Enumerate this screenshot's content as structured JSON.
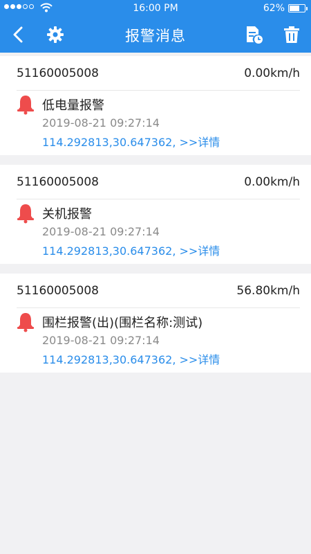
{
  "status_bar": {
    "signal_icon": "signal-dots-icon",
    "wifi_icon": "wifi-icon",
    "time": "16:00 PM",
    "battery_text": "62%",
    "battery_level": 0.62
  },
  "nav": {
    "title": "报警消息",
    "back_icon": "chevron-left-icon",
    "settings_icon": "gear-icon",
    "report_icon": "document-clock-icon",
    "delete_icon": "trash-icon"
  },
  "colors": {
    "header": "#2a8dea",
    "bell": "#ee4c4c",
    "link": "#2a8dea"
  },
  "alarms": [
    {
      "device_id": "51160005008",
      "speed": "0.00km/h",
      "title": "低电量报警",
      "time": "2019-08-21 09:27:14",
      "coords": "114.292813,30.647362, >>详情"
    },
    {
      "device_id": "51160005008",
      "speed": "0.00km/h",
      "title": "关机报警",
      "time": "2019-08-21 09:27:14",
      "coords": "114.292813,30.647362, >>详情"
    },
    {
      "device_id": "51160005008",
      "speed": "56.80km/h",
      "title": "围栏报警(出)(围栏名称:测试)",
      "time": "2019-08-21 09:27:14",
      "coords": "114.292813,30.647362, >>详情"
    }
  ]
}
